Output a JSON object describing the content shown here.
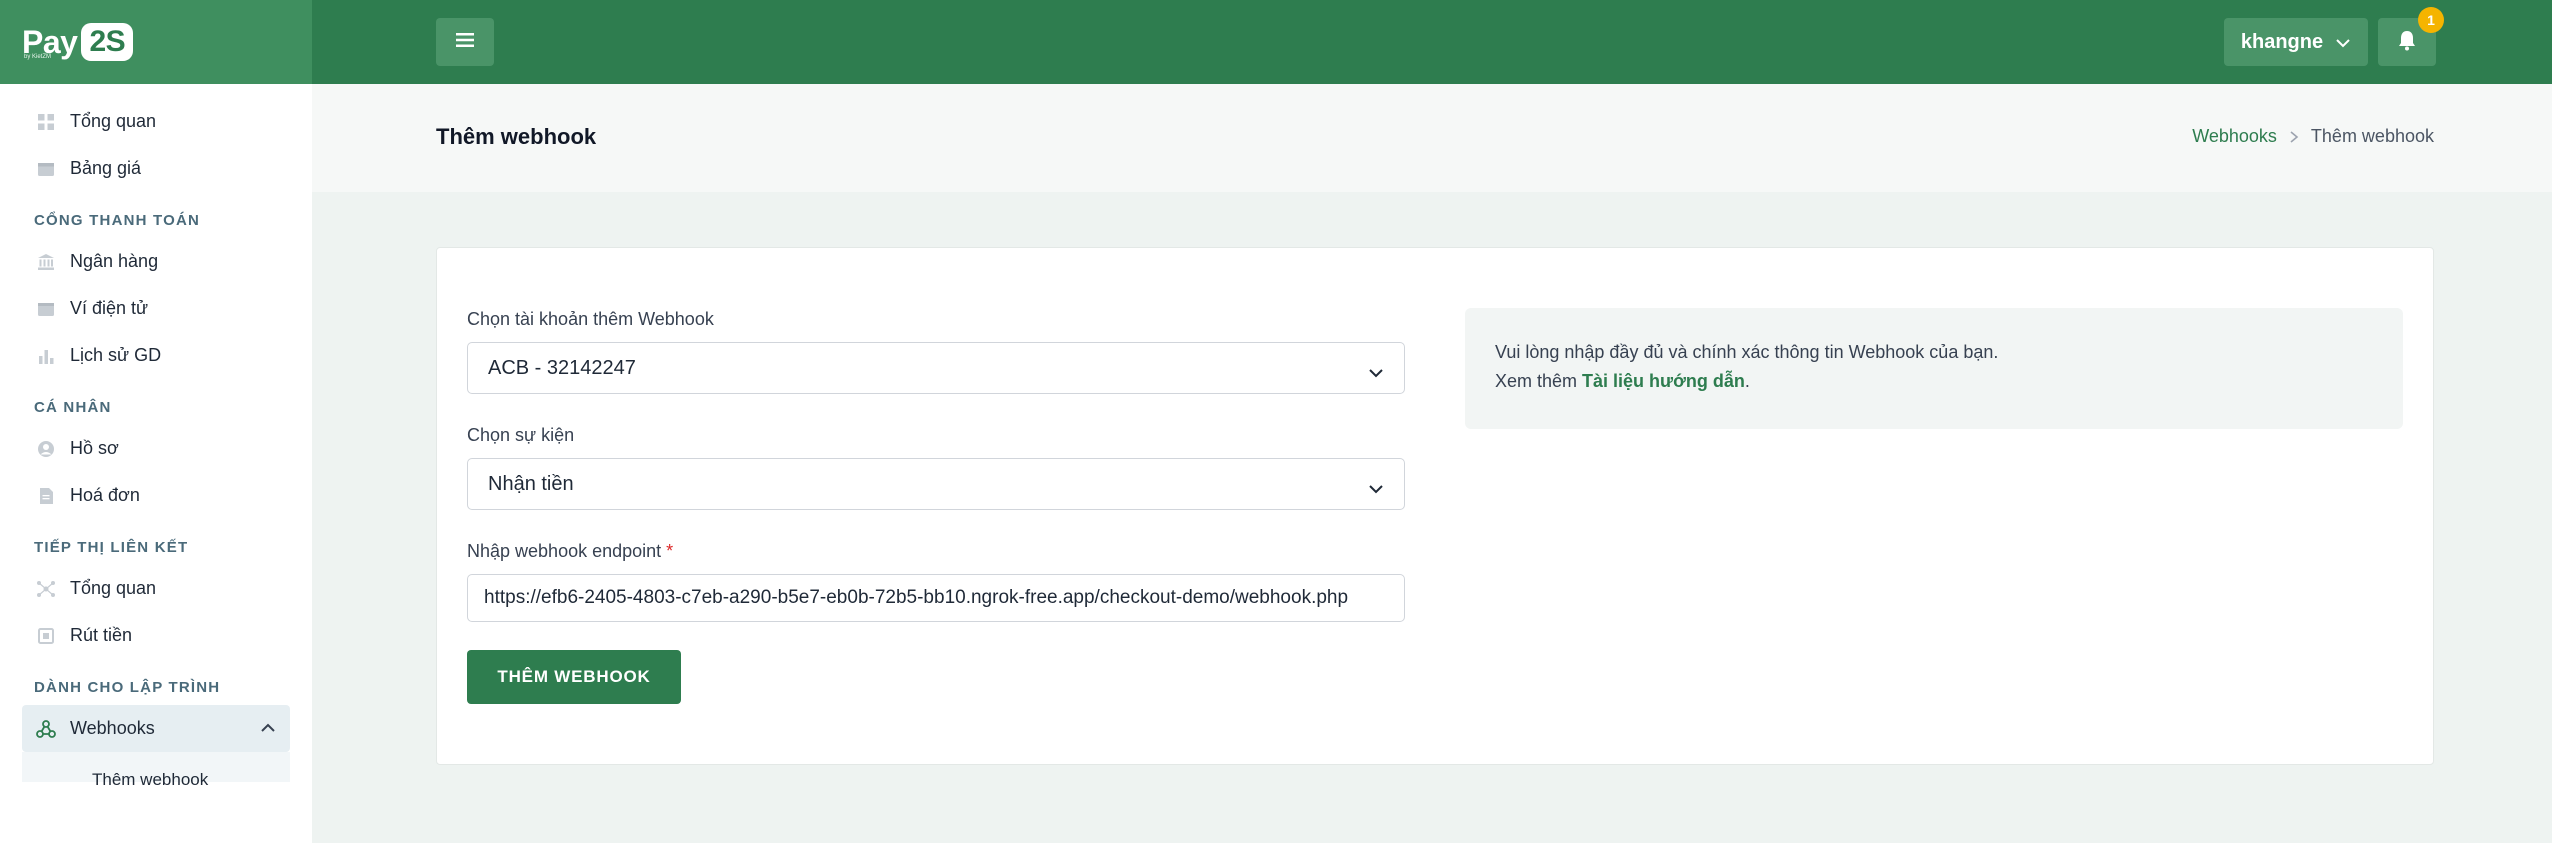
{
  "brand": {
    "name": "Pay",
    "num": "2S",
    "sub": "by KietZM"
  },
  "sidebar": {
    "items_top": [
      {
        "label": "Tổng quan",
        "icon": "grid-icon"
      },
      {
        "label": "Bảng giá",
        "icon": "tag-icon"
      }
    ],
    "sections": [
      {
        "title": "CỔNG THANH TOÁN",
        "items": [
          "Ngân hàng",
          "Ví điện tử",
          "Lịch sử GD"
        ]
      },
      {
        "title": "CÁ NHÂN",
        "items": [
          "Hồ sơ",
          "Hoá đơn"
        ]
      },
      {
        "title": "TIẾP THỊ LIÊN KẾT",
        "items": [
          "Tổng quan",
          "Rút tiền"
        ]
      },
      {
        "title": "DÀNH CHO LẬP TRÌNH",
        "items": [
          "Webhooks"
        ]
      }
    ],
    "sub_item": "Thêm webhook"
  },
  "topbar": {
    "username": "khangne",
    "notification_count": "1"
  },
  "page": {
    "title": "Thêm webhook",
    "breadcrumb": {
      "parent": "Webhooks",
      "current": "Thêm webhook"
    }
  },
  "form": {
    "account_label": "Chọn tài khoản thêm Webhook",
    "account_value": "ACB - 32142247",
    "event_label": "Chọn sự kiện",
    "event_value": "Nhận tiền",
    "endpoint_label": "Nhập webhook endpoint",
    "endpoint_required": "*",
    "endpoint_value": "https://efb6-2405-4803-c7eb-a290-b5e7-eb0b-72b5-bb10.ngrok-free.app/checkout-demo/webhook.php",
    "submit_label": "THÊM WEBHOOK"
  },
  "info": {
    "line1": "Vui lòng nhập đầy đủ và chính xác thông tin Webhook của bạn.",
    "line2_prefix": "Xem thêm ",
    "line2_link": "Tài liệu hướng dẫn",
    "line2_suffix": "."
  },
  "colors": {
    "primary": "#2e7d4f",
    "topbar_button": "#4a9468",
    "badge": "#f5b400"
  }
}
